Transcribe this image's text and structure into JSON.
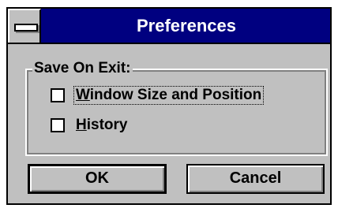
{
  "window": {
    "title": "Preferences"
  },
  "group": {
    "legend": "Save On Exit:"
  },
  "checkboxes": [
    {
      "label_hotkey": "W",
      "label_rest": "indow Size and Position",
      "checked": false
    },
    {
      "label_hotkey": "H",
      "label_rest": "istory",
      "checked": false
    }
  ],
  "buttons": {
    "ok_label": "OK",
    "cancel_label": "Cancel"
  },
  "colors": {
    "titlebar": "#000080",
    "face": "#c0c0c0",
    "highlight": "#ffffff",
    "shadow": "#808080"
  },
  "icons": {
    "system_menu": "system-menu-icon"
  }
}
